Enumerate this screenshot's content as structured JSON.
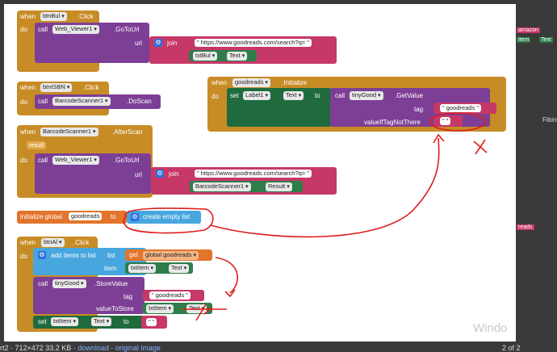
{
  "b1": {
    "when": "when",
    "btn": "btnBul",
    "event": ".Click",
    "do": "do",
    "call": "call",
    "comp": "Web_Viewer1",
    "method": ".GoToUrl",
    "url": "url",
    "join": "join",
    "str": "\" https://www.goodreads.com/search?q= \"",
    "txtcomp": "txtBul",
    "prop": "Text"
  },
  "b2": {
    "when": "when",
    "btn": "btnISBN",
    "event": ".Click",
    "do": "do",
    "call": "call",
    "comp": "BarcodeScanner1",
    "method": ".DoScan"
  },
  "b3": {
    "when": "when",
    "comp": "BarcodeScanner1",
    "event": ".AfterScan",
    "param": "result",
    "do": "do",
    "call": "call",
    "wv": "Web_Viewer1",
    "method": ".GoToUrl",
    "url": "url",
    "join": "join",
    "str": "\" https://www.goodreads.com/search?q= \"",
    "res_comp": "BarcodeScanner1",
    "res_prop": "Result"
  },
  "b4": {
    "when": "when",
    "comp": "goodreads",
    "event": ".Initialize",
    "do": "do",
    "set": "set",
    "label": "Label1",
    "prop": "Text",
    "to": "to",
    "call": "call",
    "tg": "tinyGood",
    "method": ".GetValue",
    "tag": "tag",
    "tagval": "\" goodreads \"",
    "vnt": "valueIfTagNotThere",
    "empty": "\" \""
  },
  "b5": {
    "init": "initialize global",
    "name": "goodreads",
    "to": "to",
    "create": "create empty list"
  },
  "b6": {
    "when": "when",
    "btn": "btnAl",
    "event": ".Click",
    "do": "do",
    "add": "add items to list",
    "list": "list",
    "get": "get",
    "getvar": "global goodreads",
    "item": "item",
    "itemcomp": "txtItem",
    "itemprop": "Text",
    "call": "call",
    "tg": "tinyGood",
    "method": ".StoreValue",
    "tag": "tag",
    "tagval": "\" goodreads \"",
    "vts": "valueToStore",
    "vcomp": "txtItem",
    "vprop": "Text",
    "set": "set",
    "setcomp": "txtItem",
    "setprop": "Text",
    "setto": "to",
    "empty": "\" \""
  },
  "side": {
    "t1": "amazon",
    "t2": "item",
    "t3": "Text",
    "t4": "Ftkinles",
    "t5": "reads"
  },
  "status": {
    "file": "rt2 · 712×472 33.2 KB",
    "sep": "·",
    "download": "download",
    "original": "original image",
    "pager": "2 of 2"
  },
  "windows": "Windo",
  "colors": {
    "event": "#c88c27",
    "procedure": "#7d3f95",
    "text": "#c63867",
    "list": "#48a6df",
    "variable": "#e2742b",
    "annotation": "#e01c1c"
  }
}
